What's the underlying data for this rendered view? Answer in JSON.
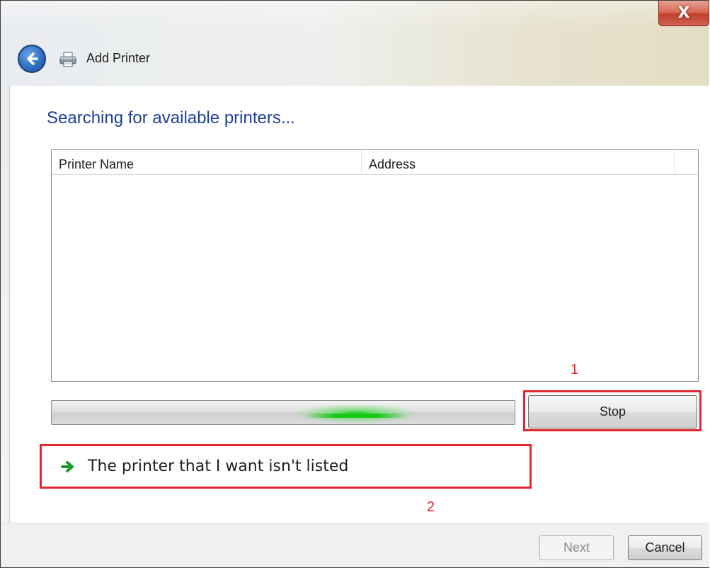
{
  "window": {
    "title": "Add Printer",
    "close_glyph": "X"
  },
  "main": {
    "heading": "Searching for available printers...",
    "list": {
      "columns": [
        "Printer Name",
        "Address"
      ],
      "rows": []
    },
    "progress": {
      "state": "indeterminate",
      "accent": "#18c818"
    },
    "stop_label": "Stop",
    "link_label": "The printer that I want isn't listed"
  },
  "footer": {
    "next_label": "Next",
    "cancel_label": "Cancel"
  },
  "annotations": {
    "label_1": "1",
    "label_2": "2",
    "color": "#e3262f"
  },
  "icons": {
    "back": "back-arrow-icon",
    "printer": "printer-icon",
    "link_arrow": "green-arrow-icon"
  }
}
